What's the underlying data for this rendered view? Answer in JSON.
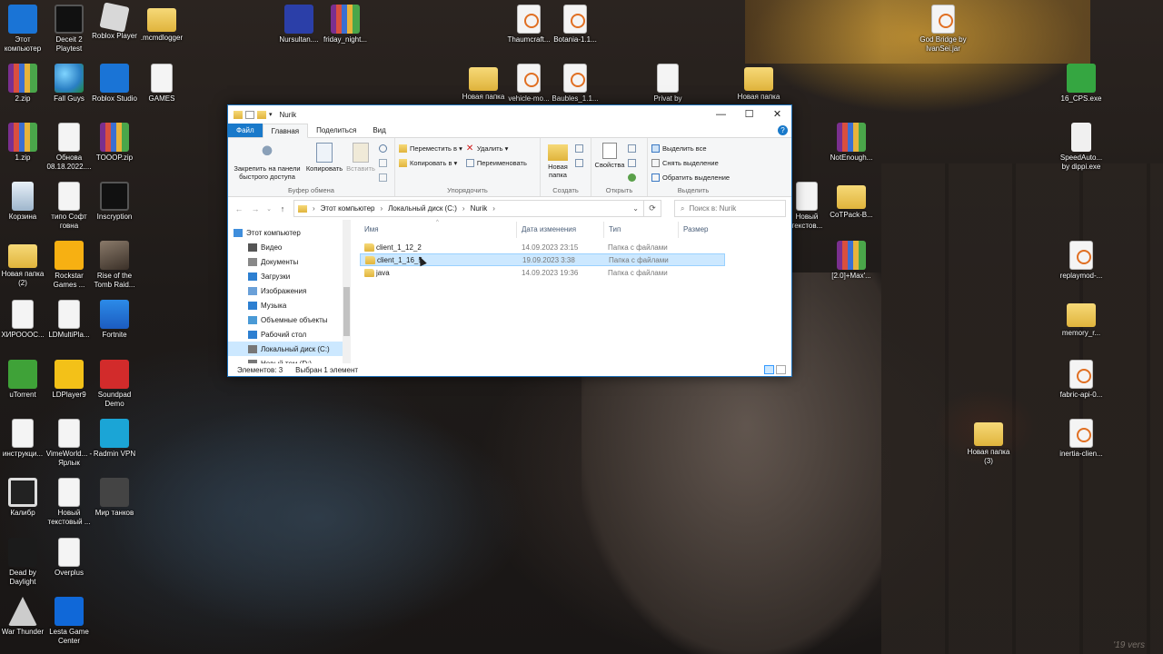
{
  "desktop_icons": [
    {
      "label": "Этот компьютер",
      "icon": "computer-icon"
    },
    {
      "label": "Deceit 2 Playtest",
      "icon": "deceit-icon"
    },
    {
      "label": "Roblox Player",
      "icon": "roblox-icon"
    },
    {
      "label": ".mcmdlogger",
      "icon": "folder-icon"
    },
    {
      "label": "Nursultan....",
      "icon": "nursultan-icon"
    },
    {
      "label": "friday_night...",
      "icon": "winrar-icon"
    },
    {
      "label": "Thaumcraft...",
      "icon": "java-file-icon"
    },
    {
      "label": "Botania-1.1...",
      "icon": "java-file-icon"
    },
    {
      "label": "God Bridge by IvanSei.jar",
      "icon": "java-file-icon"
    },
    {
      "label": "2.zip",
      "icon": "winrar-icon"
    },
    {
      "label": "Fall Guys",
      "icon": "globe-icon"
    },
    {
      "label": "Roblox Studio",
      "icon": "roblox-studio-icon"
    },
    {
      "label": "GAMES",
      "icon": "archive-icon"
    },
    {
      "label": "Новая папка",
      "icon": "folder-icon"
    },
    {
      "label": "vehicle-mo...",
      "icon": "java-file-icon"
    },
    {
      "label": "Baubles_1.1...",
      "icon": "java-file-icon"
    },
    {
      "label": "Privat by",
      "icon": "document-icon"
    },
    {
      "label": "Новая папка",
      "icon": "folder-icon"
    },
    {
      "label": "16_CPS.exe",
      "icon": "cps-app-icon"
    },
    {
      "label": "1.zip",
      "icon": "winrar-icon"
    },
    {
      "label": "Обнова 08.18.2022....",
      "icon": "document-icon"
    },
    {
      "label": "TOOOP.zip",
      "icon": "winrar-icon"
    },
    {
      "label": "NotEnough...",
      "icon": "winrar-icon"
    },
    {
      "label": "SpeedAuto... by dippi.exe",
      "icon": "mouse-icon"
    },
    {
      "label": "Корзина",
      "icon": "recycle-bin-icon"
    },
    {
      "label": "типо Софт говна",
      "icon": "document-icon"
    },
    {
      "label": "Inscryption",
      "icon": "inscryption-icon"
    },
    {
      "label": "Новый текстов...",
      "icon": "text-document-icon"
    },
    {
      "label": "CoTPack-B...",
      "icon": "folder-icon"
    },
    {
      "label": "Новая папка (2)",
      "icon": "folder-icon"
    },
    {
      "label": "Rockstar Games ...",
      "icon": "rockstar-icon"
    },
    {
      "label": "Rise of the Tomb Raid...",
      "icon": "tomb-raider-icon"
    },
    {
      "label": "[2.0]+Max'...",
      "icon": "winrar-icon"
    },
    {
      "label": "replaymod-...",
      "icon": "java-file-icon"
    },
    {
      "label": "ХИРОООС...",
      "icon": "archive-icon"
    },
    {
      "label": "LDMultiPla...",
      "icon": "document-icon"
    },
    {
      "label": "Fortnite",
      "icon": "fortnite-icon"
    },
    {
      "label": "memory_r...",
      "icon": "folder-icon"
    },
    {
      "label": "uTorrent",
      "icon": "utorrent-icon"
    },
    {
      "label": "LDPlayer9",
      "icon": "ldplayer-icon"
    },
    {
      "label": "Soundpad Demo",
      "icon": "soundpad-icon"
    },
    {
      "label": "fabric-api-0...",
      "icon": "java-file-icon"
    },
    {
      "label": "инструкци...",
      "icon": "document-icon"
    },
    {
      "label": "VimeWorld... - Ярлык",
      "icon": "document-icon"
    },
    {
      "label": "Radmin VPN",
      "icon": "radmin-icon"
    },
    {
      "label": "Новая папка (3)",
      "icon": "folder-icon"
    },
    {
      "label": "inertia-clien...",
      "icon": "java-file-icon"
    },
    {
      "label": "Калибр",
      "icon": "kalibr-icon"
    },
    {
      "label": "Новый текстовый ...",
      "icon": "text-document-icon"
    },
    {
      "label": "Мир танков",
      "icon": "tanks-icon"
    },
    {
      "label": "Dead by Daylight",
      "icon": "dbd-icon"
    },
    {
      "label": "Overplus",
      "icon": "document-icon"
    },
    {
      "label": "War Thunder",
      "icon": "war-thunder-icon"
    },
    {
      "label": "Lesta Game Center",
      "icon": "lesta-icon"
    }
  ],
  "explorer": {
    "title": "Nurik",
    "controls": {
      "minimize": "—",
      "maximize": "☐",
      "close": "✕"
    },
    "tabs": {
      "file": "Файл",
      "home": "Главная",
      "share": "Поделиться",
      "view": "Вид"
    },
    "help": "?",
    "ribbon": {
      "clipboard": {
        "label": "Буфер обмена",
        "pin": "Закрепить на панели быстрого доступа",
        "copy": "Копировать",
        "paste": "Вставить"
      },
      "organize": {
        "label": "Упорядочить",
        "move_to": "Переместить в ▾",
        "copy_to": "Копировать в ▾",
        "delete": "Удалить ▾",
        "rename": "Переименовать"
      },
      "create": {
        "label": "Создать",
        "new_folder": "Новая папка"
      },
      "open": {
        "label": "Открыть",
        "properties": "Свойства"
      },
      "select": {
        "label": "Выделить",
        "select_all": "Выделить все",
        "select_none": "Снять выделение",
        "invert": "Обратить выделение"
      }
    },
    "nav": {
      "back": "←",
      "forward": "→",
      "recent": "⌄",
      "up": "↑",
      "refresh": "⟳"
    },
    "address": {
      "sep": "›",
      "crumbs": [
        "Этот компьютер",
        "Локальный диск (C:)",
        "Nurik"
      ],
      "dropdown": "⌄"
    },
    "search": {
      "icon": "⌕",
      "placeholder": "Поиск в: Nurik"
    },
    "navpane": [
      {
        "label": "Этот компьютер",
        "icon": "computer-icon"
      },
      {
        "label": "Видео",
        "icon": "video-icon"
      },
      {
        "label": "Документы",
        "icon": "documents-icon"
      },
      {
        "label": "Загрузки",
        "icon": "downloads-icon"
      },
      {
        "label": "Изображения",
        "icon": "pictures-icon"
      },
      {
        "label": "Музыка",
        "icon": "music-icon"
      },
      {
        "label": "Объемные объекты",
        "icon": "3d-objects-icon"
      },
      {
        "label": "Рабочий стол",
        "icon": "desktop-icon"
      },
      {
        "label": "Локальный диск (C:)",
        "icon": "drive-icon"
      },
      {
        "label": "Новый том (D:)",
        "icon": "drive-icon"
      }
    ],
    "columns": {
      "name": "Имя",
      "date": "Дата изменения",
      "type": "Тип",
      "size": "Размер",
      "sort_arrow": "^"
    },
    "files": [
      {
        "name": "client_1_12_2",
        "date": "14.09.2023 23:15",
        "type": "Папка с файлами"
      },
      {
        "name": "client_1_16_5",
        "date": "19.09.2023 3:38",
        "type": "Папка с файлами"
      },
      {
        "name": "java",
        "date": "14.09.2023 19:36",
        "type": "Папка с файлами"
      }
    ],
    "status": {
      "count": "Элементов: 3",
      "selected": "Выбран 1 элемент"
    }
  },
  "watermark": "'19 vers"
}
